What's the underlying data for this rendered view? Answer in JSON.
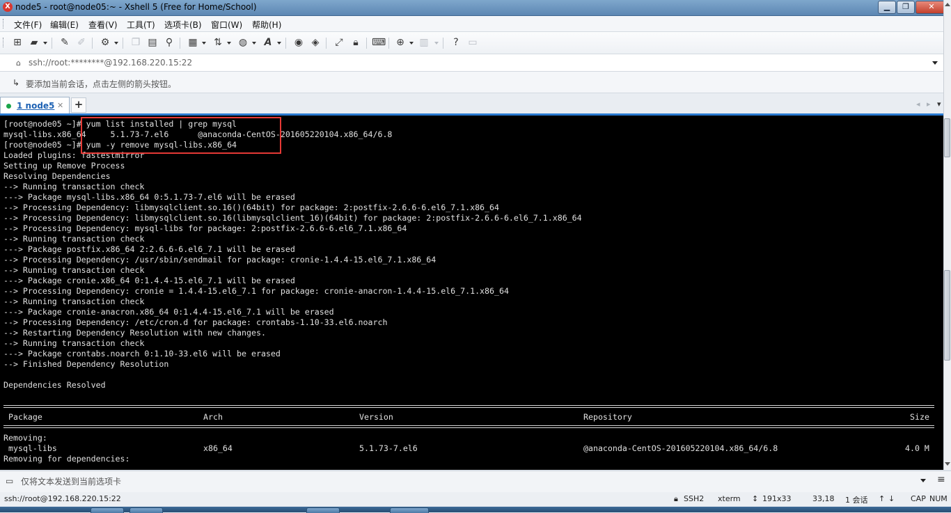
{
  "window": {
    "title": "node5 - root@node05:~ - Xshell 5 (Free for Home/School)",
    "app_icon_glyph": "X",
    "minimize_glyph": "▁",
    "maximize_glyph": "❐",
    "close_glyph": "✕"
  },
  "menu": {
    "items": [
      "文件(F)",
      "编辑(E)",
      "查看(V)",
      "工具(T)",
      "选项卡(B)",
      "窗口(W)",
      "帮助(H)"
    ]
  },
  "toolbar": {
    "icons": [
      "new-session-icon",
      "open-folder-icon",
      "reconnect-icon",
      "disconnect-icon",
      "properties-icon",
      "copy-icon",
      "paste-icon",
      "find-icon",
      "print-icon",
      "transfer-icon",
      "globe-icon",
      "font-icon",
      "xftp-icon",
      "xmanager-icon",
      "fullscreen-icon",
      "lock-icon",
      "keyboard-icon",
      "add-tab-icon",
      "layout-icon",
      "help-icon",
      "chat-icon"
    ]
  },
  "address": {
    "text": "ssh://root:********@192.168.220.15:22"
  },
  "hint": {
    "text": "要添加当前会话，点击左侧的箭头按钮。"
  },
  "tabs": [
    {
      "label": "1 node5",
      "status": "connected",
      "status_color": "#1ba54a"
    }
  ],
  "terminal": {
    "lines": [
      "[root@node05 ~]# yum list installed | grep mysql",
      "mysql-libs.x86_64     5.1.73-7.el6      @anaconda-CentOS-201605220104.x86_64/6.8",
      "[root@node05 ~]# yum -y remove mysql-libs.x86_64",
      "Loaded plugins: fastestmirror",
      "Setting up Remove Process",
      "Resolving Dependencies",
      "--> Running transaction check",
      "---> Package mysql-libs.x86_64 0:5.1.73-7.el6 will be erased",
      "--> Processing Dependency: libmysqlclient.so.16()(64bit) for package: 2:postfix-2.6.6-6.el6_7.1.x86_64",
      "--> Processing Dependency: libmysqlclient.so.16(libmysqlclient_16)(64bit) for package: 2:postfix-2.6.6-6.el6_7.1.x86_64",
      "--> Processing Dependency: mysql-libs for package: 2:postfix-2.6.6-6.el6_7.1.x86_64",
      "--> Running transaction check",
      "---> Package postfix.x86_64 2:2.6.6-6.el6_7.1 will be erased",
      "--> Processing Dependency: /usr/sbin/sendmail for package: cronie-1.4.4-15.el6_7.1.x86_64",
      "--> Running transaction check",
      "---> Package cronie.x86_64 0:1.4.4-15.el6_7.1 will be erased",
      "--> Processing Dependency: cronie = 1.4.4-15.el6_7.1 for package: cronie-anacron-1.4.4-15.el6_7.1.x86_64",
      "--> Running transaction check",
      "---> Package cronie-anacron.x86_64 0:1.4.4-15.el6_7.1 will be erased",
      "--> Processing Dependency: /etc/cron.d for package: crontabs-1.10-33.el6.noarch",
      "--> Restarting Dependency Resolution with new changes.",
      "--> Running transaction check",
      "---> Package crontabs.noarch 0:1.10-33.el6 will be erased",
      "--> Finished Dependency Resolution",
      "",
      "Dependencies Resolved"
    ],
    "table": {
      "headers": {
        "package": "Package",
        "arch": "Arch",
        "version": "Version",
        "repository": "Repository",
        "size": "Size"
      },
      "section_removing": "Removing:",
      "row": {
        "package": "mysql-libs",
        "arch": "x86_64",
        "version": "5.1.73-7.el6",
        "repository": "@anaconda-CentOS-201605220104.x86_64/6.8",
        "size": "4.0 M"
      },
      "section_deps": "Removing for dependencies:"
    },
    "highlight_color": "#e53935"
  },
  "compose": {
    "text": "仅将文本发送到当前选项卡"
  },
  "status": {
    "connection": "ssh://root@192.168.220.15:22",
    "protocol": "SSH2",
    "terminal_type": "xterm",
    "size": "191x33",
    "cursor": "33,18",
    "sessions": "1 会话",
    "caps": "CAP",
    "num": "NUM"
  }
}
